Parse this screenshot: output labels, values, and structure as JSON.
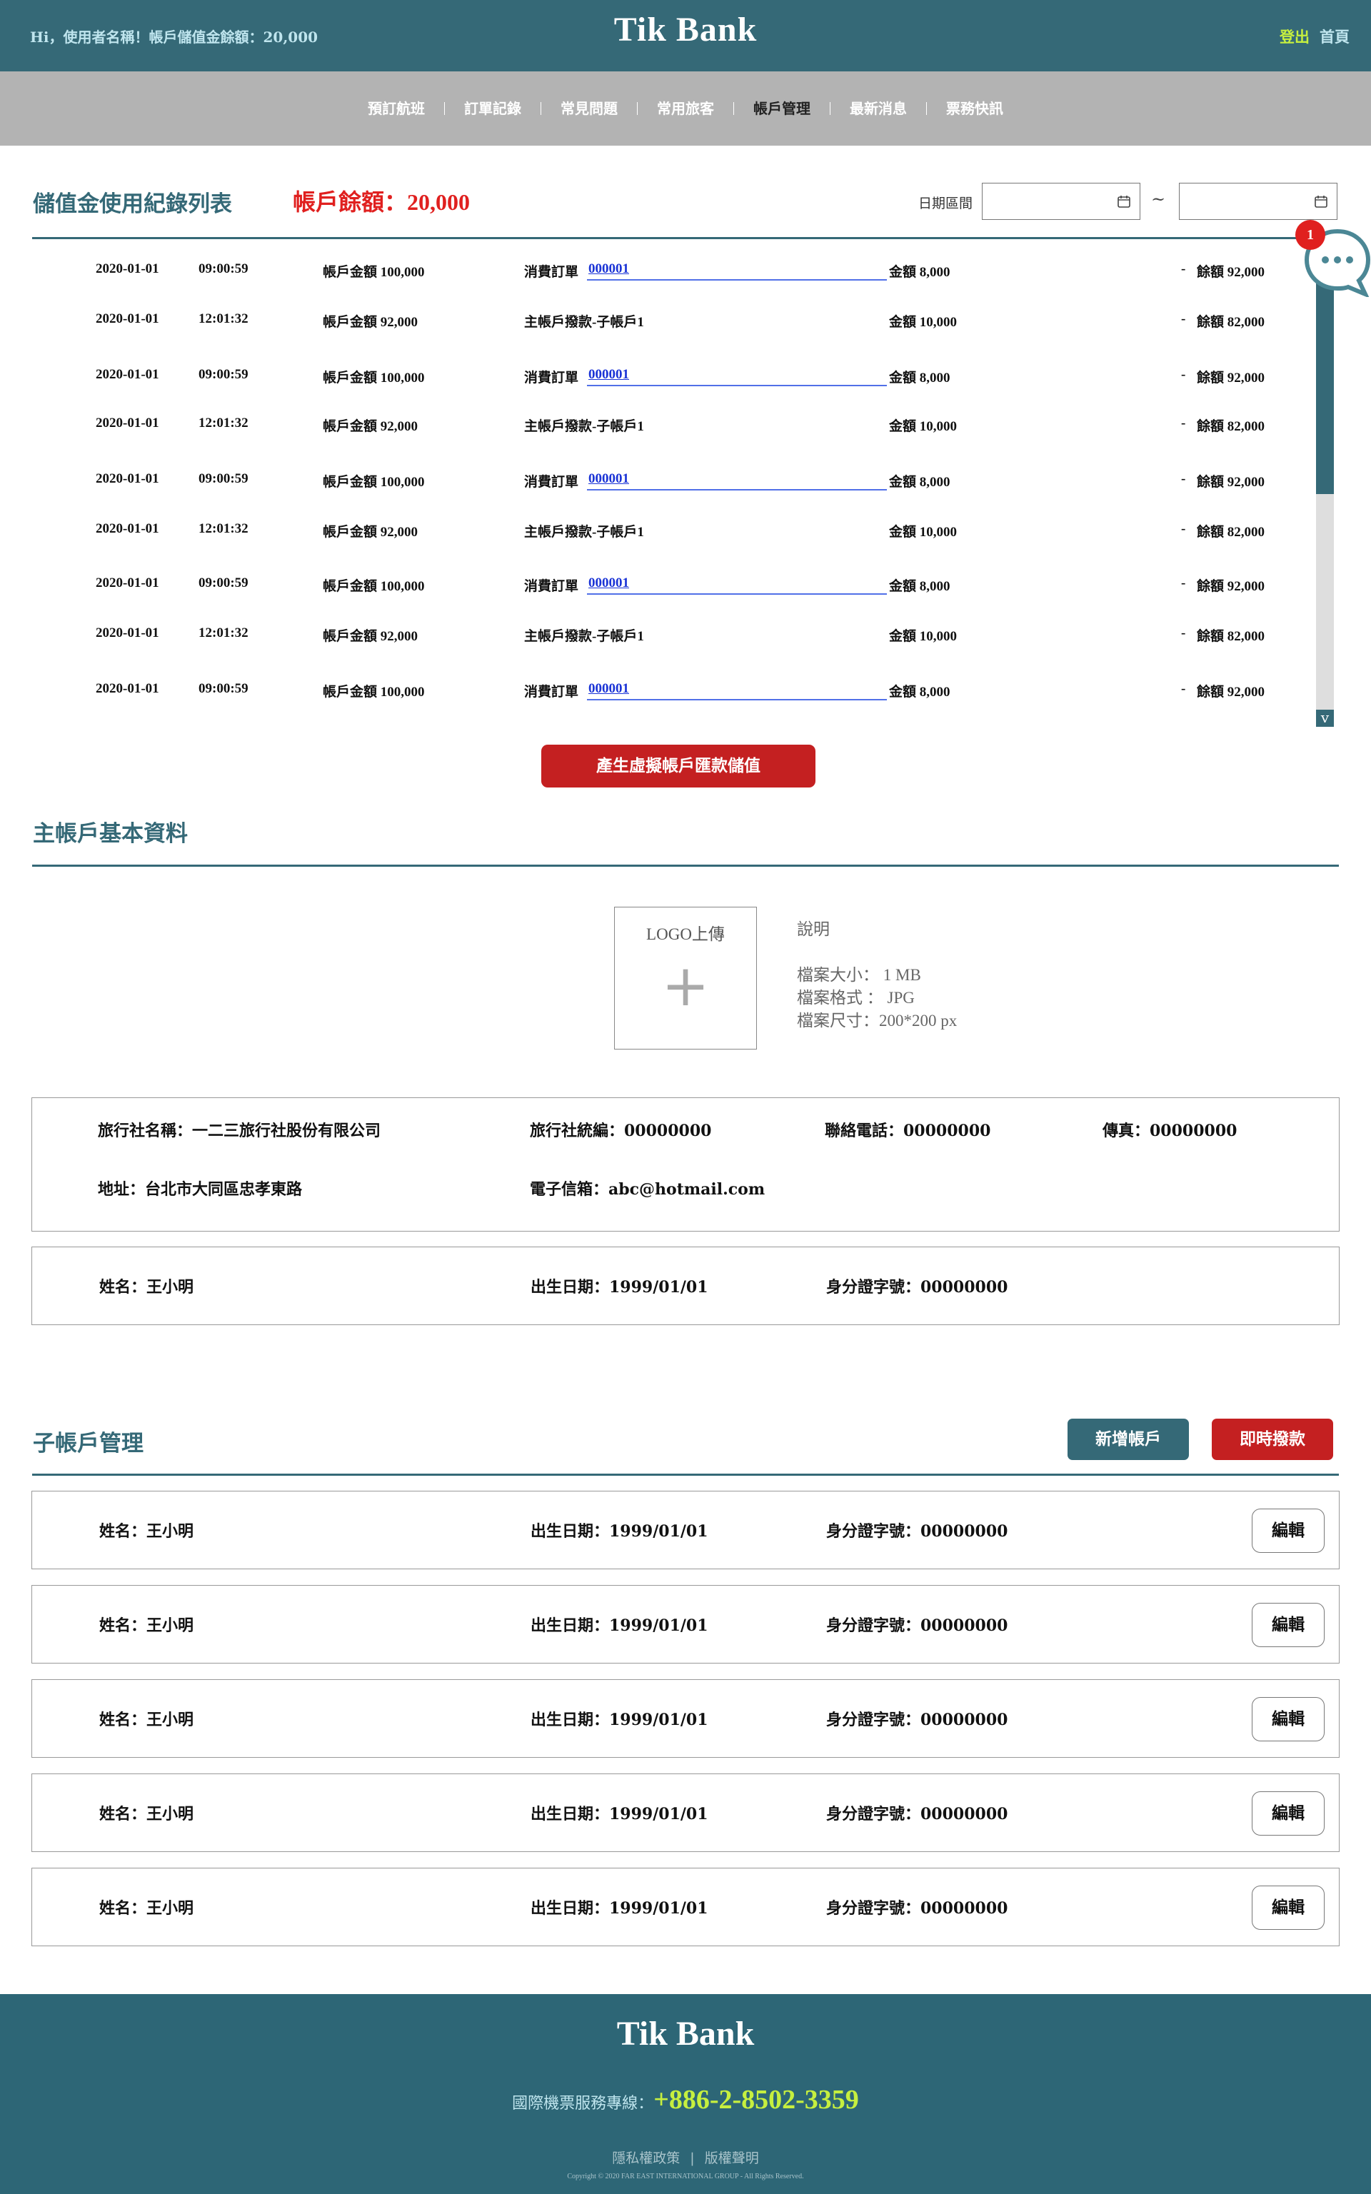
{
  "header": {
    "greeting": "Hi，使用者名稱！帳戶儲值金餘額：20,000",
    "logo": "Tik Bank",
    "logout": "登出",
    "home": "首頁"
  },
  "nav": [
    "預訂航班",
    "訂單記錄",
    "常見問題",
    "常用旅客",
    "帳戶管理",
    "最新消息",
    "票務快訊"
  ],
  "nav_active": "帳戶管理",
  "records_section": {
    "title": "儲值金使用紀錄列表",
    "balance": "帳戶餘額：20,000",
    "date_label": "日期區間",
    "date_from": "",
    "date_to": "",
    "separator": "~",
    "records": [
      {
        "date": "2020-01-01",
        "time": "09:00:59",
        "account": "帳戶金額 100,000",
        "desc": "消費訂單",
        "order": "000001",
        "amount": "金額 8,000",
        "sign": "-",
        "balance": "餘額 92,000"
      },
      {
        "date": "2020-01-01",
        "time": "12:01:32",
        "account": "帳戶金額 92,000",
        "desc": "主帳戶撥款-子帳戶1",
        "order": "",
        "amount": "金額 10,000",
        "sign": "-",
        "balance": "餘額 82,000"
      },
      {
        "date": "2020-01-01",
        "time": "09:00:59",
        "account": "帳戶金額 100,000",
        "desc": "消費訂單",
        "order": "000001",
        "amount": "金額 8,000",
        "sign": "-",
        "balance": "餘額 92,000"
      },
      {
        "date": "2020-01-01",
        "time": "12:01:32",
        "account": "帳戶金額 92,000",
        "desc": "主帳戶撥款-子帳戶1",
        "order": "",
        "amount": "金額 10,000",
        "sign": "-",
        "balance": "餘額 82,000"
      },
      {
        "date": "2020-01-01",
        "time": "09:00:59",
        "account": "帳戶金額 100,000",
        "desc": "消費訂單",
        "order": "000001",
        "amount": "金額 8,000",
        "sign": "-",
        "balance": "餘額 92,000"
      },
      {
        "date": "2020-01-01",
        "time": "12:01:32",
        "account": "帳戶金額 92,000",
        "desc": "主帳戶撥款-子帳戶1",
        "order": "",
        "amount": "金額 10,000",
        "sign": "-",
        "balance": "餘額 82,000"
      },
      {
        "date": "2020-01-01",
        "time": "09:00:59",
        "account": "帳戶金額 100,000",
        "desc": "消費訂單",
        "order": "000001",
        "amount": "金額 8,000",
        "sign": "-",
        "balance": "餘額 92,000"
      },
      {
        "date": "2020-01-01",
        "time": "12:01:32",
        "account": "帳戶金額 92,000",
        "desc": "主帳戶撥款-子帳戶1",
        "order": "",
        "amount": "金額 10,000",
        "sign": "-",
        "balance": "餘額 82,000"
      },
      {
        "date": "2020-01-01",
        "time": "09:00:59",
        "account": "帳戶金額 100,000",
        "desc": "消費訂單",
        "order": "000001",
        "amount": "金額 8,000",
        "sign": "-",
        "balance": "餘額 92,000"
      }
    ],
    "scroll_arrow": "v",
    "chat_badge": "1",
    "generate_button": "產生虛擬帳戶匯款儲值"
  },
  "main_account": {
    "title": "主帳戶基本資料",
    "logo_upload_label": "LOGO上傳",
    "logo_upload_plus": "+",
    "desc_title": "說明",
    "desc_lines": [
      "檔案大小： 1 MB",
      "檔案格式 ： JPG",
      "檔案尺寸：200*200 px"
    ],
    "agency": {
      "name": "旅行社名稱：一二三旅行社股份有限公司",
      "tax_id": "旅行社統編：00000000",
      "phone": "聯絡電話：00000000",
      "fax": "傳真：00000000",
      "address": "地址：台北市大同區忠孝東路",
      "email": "電子信箱：abc@hotmail.com"
    },
    "person": {
      "name": "姓名：王小明",
      "birth": "出生日期：1999/01/01",
      "id": "身分證字號：00000000"
    }
  },
  "sub_accounts": {
    "title": "子帳戶管理",
    "add_button": "新增帳戶",
    "transfer_button": "即時撥款",
    "edit_label": "編輯",
    "items": [
      {
        "name": "姓名：王小明",
        "birth": "出生日期：1999/01/01",
        "id": "身分證字號：00000000"
      },
      {
        "name": "姓名：王小明",
        "birth": "出生日期：1999/01/01",
        "id": "身分證字號：00000000"
      },
      {
        "name": "姓名：王小明",
        "birth": "出生日期：1999/01/01",
        "id": "身分證字號：00000000"
      },
      {
        "name": "姓名：王小明",
        "birth": "出生日期：1999/01/01",
        "id": "身分證字號：00000000"
      },
      {
        "name": "姓名：王小明",
        "birth": "出生日期：1999/01/01",
        "id": "身分證字號：00000000"
      }
    ]
  },
  "footer": {
    "logo": "Tik Bank",
    "hotline_label": "國際機票服務專線：",
    "hotline_number": "+886-2-8502-3359",
    "privacy": "隱私權政策",
    "divider": "|",
    "copyright_link": "版權聲明",
    "copyright": "Copyright © 2020 FAR EAST INTERNATIONAL GROUP - All Rights Reserved."
  },
  "colors": {
    "primary": "#356977",
    "accent_red": "#c42021",
    "balance_red": "#e0201f",
    "highlight_green": "#c6ef3f",
    "nav_gray": "#b3b3b3"
  }
}
